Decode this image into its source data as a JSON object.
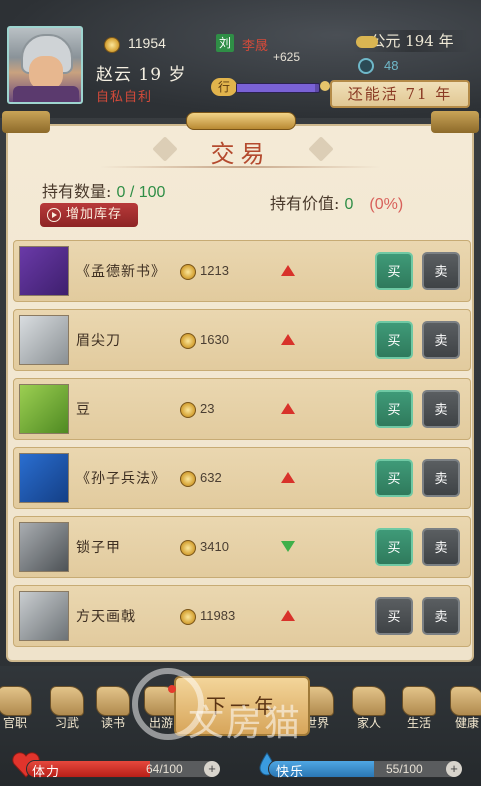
{
  "header": {
    "gold": "11954",
    "name": "赵云 19 岁",
    "trait": "自私自利",
    "faction": "刘",
    "lord": "李晟",
    "lord_delta": "+625",
    "action_tag": "行",
    "action_progress": 0.95,
    "year": "公元 194 年",
    "orb_value": "48",
    "life_left": "还能活 71 年"
  },
  "trade": {
    "title": "交易",
    "hold_count_label": "持有数量: ",
    "hold_count_value": "0 / 100",
    "hold_value_label": "持有价值: ",
    "hold_value_value": "0",
    "hold_value_percent": "(0%)",
    "add_stock_label": "增加库存",
    "buy_label": "买",
    "sell_label": "卖",
    "items": [
      {
        "name": "《孟德新书》",
        "price": "1213",
        "trend": "up",
        "buy_enabled": true,
        "icon": "book-purple-icon"
      },
      {
        "name": "眉尖刀",
        "price": "1630",
        "trend": "up",
        "buy_enabled": true,
        "icon": "blade-icon"
      },
      {
        "name": "豆",
        "price": "23",
        "trend": "up",
        "buy_enabled": true,
        "icon": "bean-icon"
      },
      {
        "name": "《孙子兵法》",
        "price": "632",
        "trend": "up",
        "buy_enabled": true,
        "icon": "book-blue-icon"
      },
      {
        "name": "锁子甲",
        "price": "3410",
        "trend": "down",
        "buy_enabled": true,
        "icon": "armor-icon"
      },
      {
        "name": "方天画戟",
        "price": "11983",
        "trend": "up",
        "buy_enabled": false,
        "icon": "halberd-icon"
      }
    ]
  },
  "nav": {
    "items": [
      "官职",
      "习武",
      "读书",
      "出游",
      "世界",
      "家人",
      "生活",
      "健康"
    ],
    "next_year": "下一年"
  },
  "stats": {
    "hp_label": "体力",
    "hp_value": "64/100",
    "hp_fraction": 0.64,
    "joy_label": "快乐",
    "joy_value": "55/100",
    "joy_fraction": 0.55
  },
  "watermark": "文房猫",
  "colors": {
    "up": "#d8322a",
    "down": "#3fb04a",
    "buy": "#2f7a5c",
    "accent": "#b44a2e"
  }
}
